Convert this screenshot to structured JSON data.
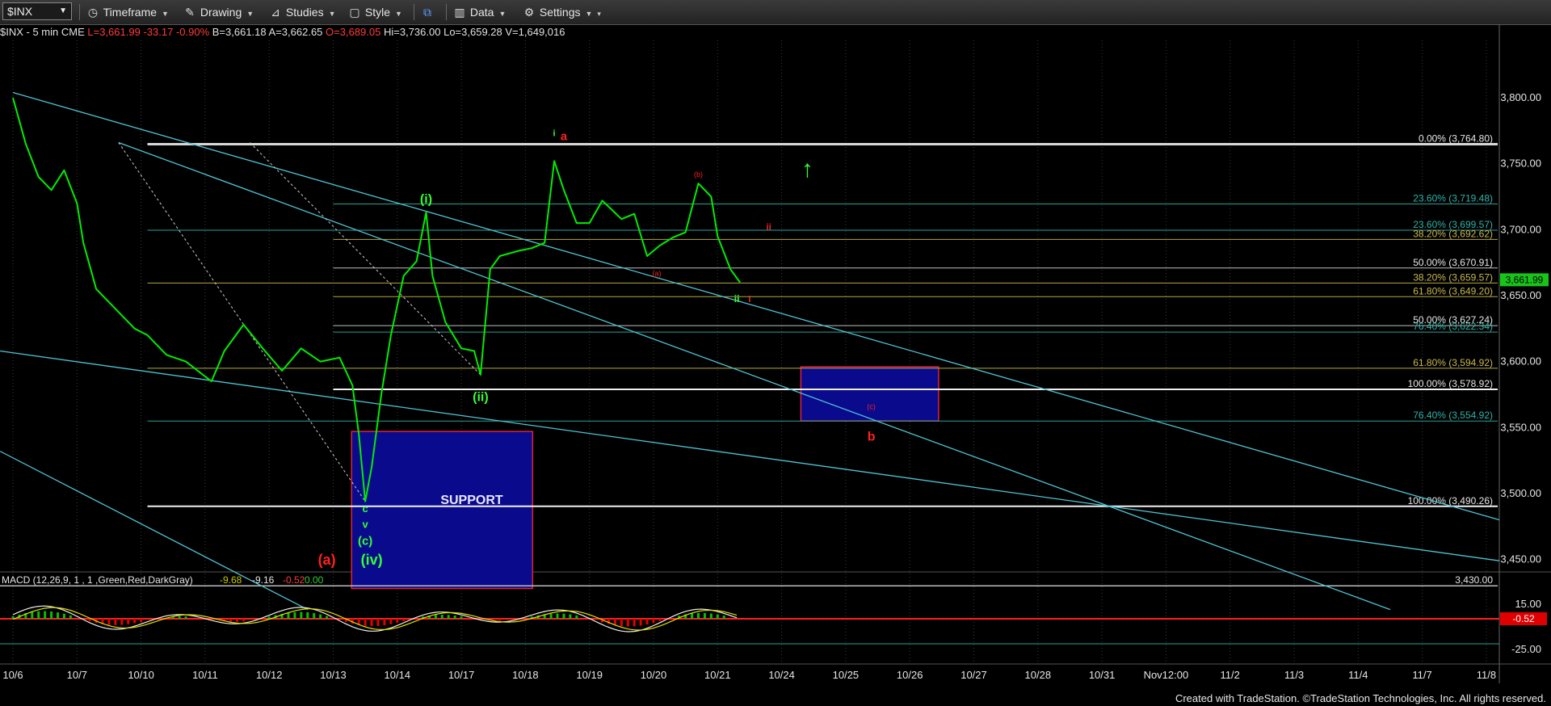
{
  "toolbar": {
    "symbol": "$INX",
    "items": [
      "Timeframe",
      "Drawing",
      "Studies",
      "Style",
      "Data",
      "Settings"
    ]
  },
  "infobar": {
    "name": "$INX - 5 min  CME",
    "last": "L=3,661.99",
    "change": "-33.17",
    "pct": "-0.90%",
    "bid": "B=3,661.18",
    "ask": "A=3,662.65",
    "open": "O=3,689.05",
    "high": "Hi=3,736.00",
    "low": "Lo=3,659.28",
    "volume": "V=1,649,016"
  },
  "colors": {
    "price": "#00ee00",
    "channel": "#4fc3d4",
    "wave_red": "#ff2020",
    "wave_green": "#33ff33",
    "box": "#0a0a8c"
  },
  "chart_data": {
    "type": "line",
    "title": "",
    "x_ticks": [
      "10/6",
      "10/7",
      "10/10",
      "10/11",
      "10/12",
      "10/13",
      "10/14",
      "10/17",
      "10/18",
      "10/19",
      "10/20",
      "10/21",
      "10/24",
      "10/25",
      "10/26",
      "10/27",
      "10/28",
      "10/31",
      "Nov12:00",
      "11/2",
      "11/3",
      "11/4",
      "11/7",
      "11/8"
    ],
    "y_ticks": [
      "3,800.00",
      "3,750.00",
      "3,700.00",
      "3,650.00",
      "3,600.00",
      "3,550.00",
      "3,500.00",
      "3,450.00"
    ],
    "ylim": [
      3415,
      3855
    ],
    "last_price_label": "3,661.99",
    "price_series": [
      [
        0,
        3800
      ],
      [
        0.2,
        3765
      ],
      [
        0.4,
        3740
      ],
      [
        0.6,
        3730
      ],
      [
        0.8,
        3745
      ],
      [
        1,
        3720
      ],
      [
        1.1,
        3690
      ],
      [
        1.3,
        3655
      ],
      [
        1.6,
        3640
      ],
      [
        1.9,
        3625
      ],
      [
        2.1,
        3620
      ],
      [
        2.4,
        3605
      ],
      [
        2.7,
        3600
      ],
      [
        3.1,
        3585
      ],
      [
        3.3,
        3608
      ],
      [
        3.6,
        3628
      ],
      [
        3.9,
        3610
      ],
      [
        4.2,
        3593
      ],
      [
        4.5,
        3610
      ],
      [
        4.8,
        3600
      ],
      [
        5.1,
        3603
      ],
      [
        5.3,
        3582
      ],
      [
        5.4,
        3545
      ],
      [
        5.5,
        3494
      ],
      [
        5.6,
        3520
      ],
      [
        5.75,
        3575
      ],
      [
        5.9,
        3620
      ],
      [
        6.1,
        3665
      ],
      [
        6.3,
        3676
      ],
      [
        6.45,
        3713
      ],
      [
        6.55,
        3665
      ],
      [
        6.75,
        3630
      ],
      [
        7.0,
        3610
      ],
      [
        7.2,
        3608
      ],
      [
        7.3,
        3590
      ],
      [
        7.45,
        3670
      ],
      [
        7.6,
        3680
      ],
      [
        7.9,
        3684
      ],
      [
        8.1,
        3686
      ],
      [
        8.3,
        3690
      ],
      [
        8.45,
        3752
      ],
      [
        8.6,
        3730
      ],
      [
        8.8,
        3705
      ],
      [
        9.0,
        3705
      ],
      [
        9.2,
        3722
      ],
      [
        9.5,
        3708
      ],
      [
        9.7,
        3712
      ],
      [
        9.9,
        3680
      ],
      [
        10.1,
        3688
      ],
      [
        10.3,
        3694
      ],
      [
        10.5,
        3698
      ],
      [
        10.7,
        3735
      ],
      [
        10.9,
        3725
      ],
      [
        11.0,
        3695
      ],
      [
        11.2,
        3670
      ],
      [
        11.35,
        3660
      ]
    ],
    "fib_labels": [
      {
        "text": "0.00% (3,764.80)",
        "y": 3764.8
      },
      {
        "text": "23.60% (3,719.48)",
        "y": 3719.48
      },
      {
        "text": "23.60% (3,699.57)",
        "y": 3699.57
      },
      {
        "text": "38.20% (3,692.62)",
        "y": 3692.62
      },
      {
        "text": "50.00% (3,670.91)",
        "y": 3670.91
      },
      {
        "text": "38.20% (3,659.57)",
        "y": 3659.57
      },
      {
        "text": "61.80% (3,649.20)",
        "y": 3649.2
      },
      {
        "text": "50.00% (3,627.24)",
        "y": 3627.24
      },
      {
        "text": "76.40% (3,622.34)",
        "y": 3622.34
      },
      {
        "text": "61.80% (3,594.92)",
        "y": 3594.92
      },
      {
        "text": "100.00% (3,578.92)",
        "y": 3578.92
      },
      {
        "text": "76.40% (3,554.92)",
        "y": 3554.92
      },
      {
        "text": "100.00% (3,490.26)",
        "y": 3490.26
      },
      {
        "text": "3,430.00",
        "y": 3430
      }
    ],
    "support_label": "SUPPORT",
    "wave_labels_green": [
      "(i)",
      "(ii)",
      "c",
      "v",
      "(c)",
      "(iv)",
      "ii",
      "↑"
    ],
    "wave_labels_red": [
      "(a)",
      "a",
      "i",
      "(b)",
      "(a)",
      "ii",
      "i",
      "(c)",
      "b"
    ],
    "macd": {
      "label": "MACD (12,26,9, 1 , 1 ,Green,Red,DarkGray)",
      "values": [
        "-9.68",
        "-9.16",
        "-0.52",
        "0.00"
      ],
      "y_ticks": [
        "15.00",
        "-25.00"
      ],
      "last_label": "-0.52"
    }
  },
  "footer": "Created with TradeStation. ©TradeStation Technologies, Inc. All rights reserved."
}
